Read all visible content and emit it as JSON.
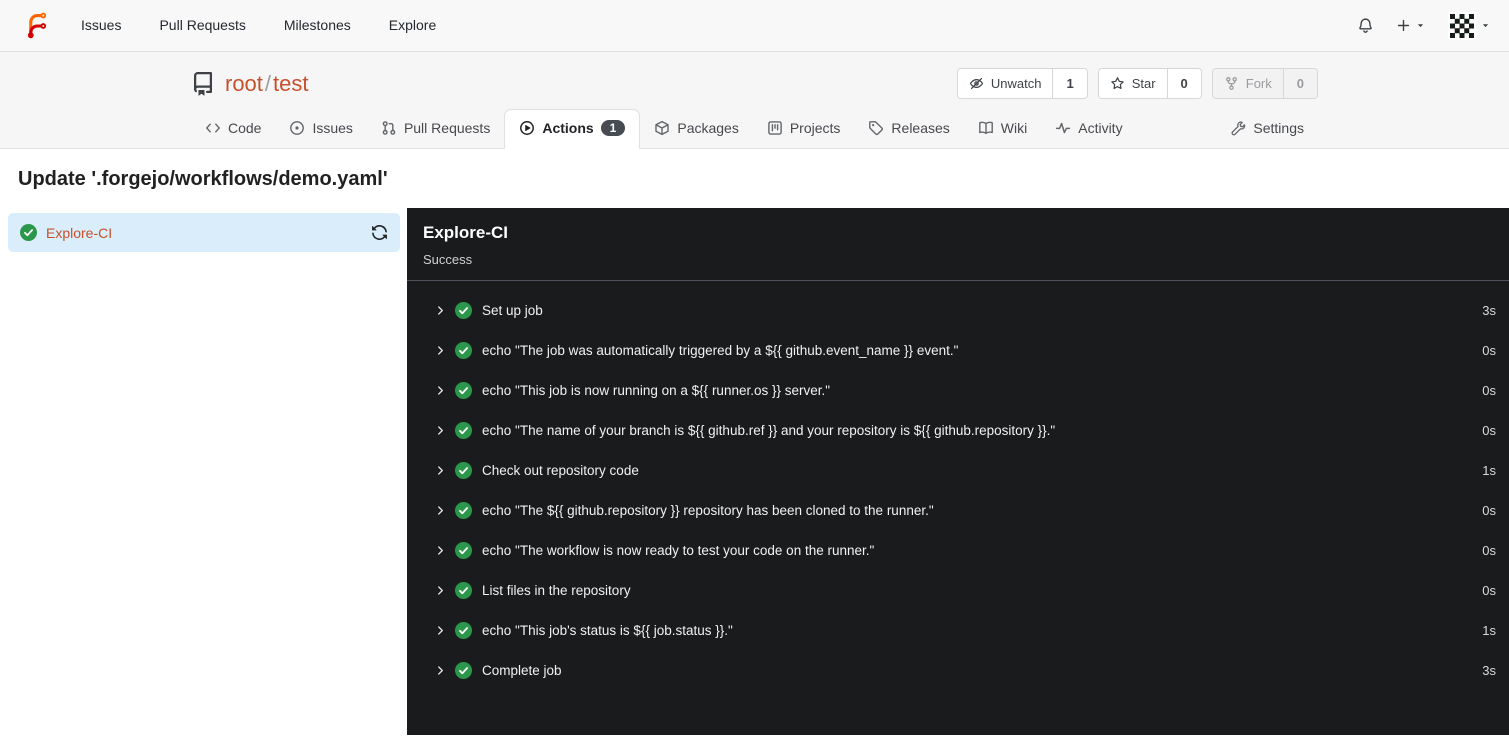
{
  "colors": {
    "accent_orange": "#c5512c",
    "success_green": "#2c974b",
    "panel_background": "#1a1b1d",
    "sidebar_highlight": "#d9edfb",
    "badge_background": "#474c52",
    "header_background": "#f6f6f7"
  },
  "icons": {
    "brand": "forgejo-logo",
    "notifications": "bell-icon",
    "create_new": "plus-icon",
    "user_menu": "avatar-identicon",
    "repository": "repo-book-icon",
    "unwatch": "eye-slash-icon",
    "star": "star-icon",
    "fork": "git-fork-icon",
    "job_status": "check-circle-icon",
    "rerun": "sync-icon",
    "step_expand": "chevron-right-icon"
  },
  "navbar": {
    "links": [
      "Issues",
      "Pull Requests",
      "Milestones",
      "Explore"
    ]
  },
  "repo": {
    "owner": "root",
    "separator": "/",
    "name": "test",
    "buttons": [
      {
        "label": "Unwatch",
        "count": "1"
      },
      {
        "label": "Star",
        "count": "0"
      },
      {
        "label": "Fork",
        "count": "0",
        "disabled": true
      }
    ]
  },
  "tabs": [
    {
      "label": "Code"
    },
    {
      "label": "Issues"
    },
    {
      "label": "Pull Requests"
    },
    {
      "label": "Actions",
      "badge": "1",
      "active": true
    },
    {
      "label": "Packages"
    },
    {
      "label": "Projects"
    },
    {
      "label": "Releases"
    },
    {
      "label": "Wiki"
    },
    {
      "label": "Activity"
    },
    {
      "label": "Settings"
    }
  ],
  "page": {
    "title": "Update '.forgejo/workflows/demo.yaml'"
  },
  "sidebar": {
    "job": {
      "name": "Explore-CI"
    }
  },
  "panel": {
    "title": "Explore-CI",
    "status": "Success"
  },
  "steps": [
    {
      "name": "Set up job",
      "duration": "3s"
    },
    {
      "name": "echo \"The job was automatically triggered by a ${{ github.event_name }} event.\"",
      "duration": "0s"
    },
    {
      "name": "echo \"This job is now running on a ${{ runner.os }} server.\"",
      "duration": "0s"
    },
    {
      "name": "echo \"The name of your branch is ${{ github.ref }} and your repository is ${{ github.repository }}.\"",
      "duration": "0s"
    },
    {
      "name": "Check out repository code",
      "duration": "1s"
    },
    {
      "name": "echo \"The ${{ github.repository }} repository has been cloned to the runner.\"",
      "duration": "0s"
    },
    {
      "name": "echo \"The workflow is now ready to test your code on the runner.\"",
      "duration": "0s"
    },
    {
      "name": "List files in the repository",
      "duration": "0s"
    },
    {
      "name": "echo \"This job's status is ${{ job.status }}.\"",
      "duration": "1s"
    },
    {
      "name": "Complete job",
      "duration": "3s"
    }
  ]
}
